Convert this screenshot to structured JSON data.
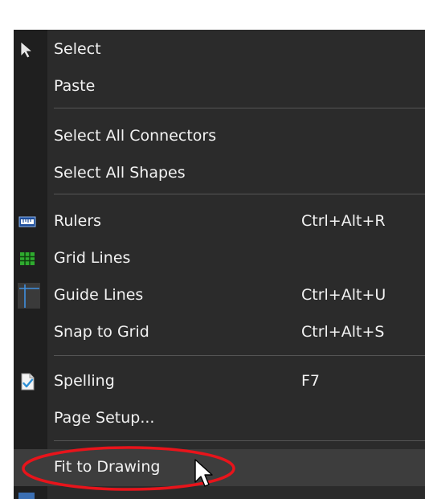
{
  "menu": {
    "items": [
      {
        "label": "Select",
        "shortcut": "",
        "icon": "arrow-cursor-icon"
      },
      {
        "label": "Paste",
        "shortcut": "",
        "icon": ""
      },
      {
        "label": "Select All Connectors",
        "shortcut": "",
        "icon": ""
      },
      {
        "label": "Select All Shapes",
        "shortcut": "",
        "icon": ""
      },
      {
        "label": "Rulers",
        "shortcut": "Ctrl+Alt+R",
        "icon": "ruler-icon"
      },
      {
        "label": "Grid Lines",
        "shortcut": "",
        "icon": "grid-icon"
      },
      {
        "label": "Guide Lines",
        "shortcut": "Ctrl+Alt+U",
        "icon": "guide-lines-icon"
      },
      {
        "label": "Snap to Grid",
        "shortcut": "Ctrl+Alt+S",
        "icon": ""
      },
      {
        "label": "Spelling",
        "shortcut": "F7",
        "icon": "spelling-check-icon"
      },
      {
        "label": "Page Setup...",
        "shortcut": "",
        "icon": ""
      },
      {
        "label": "Fit to Drawing",
        "shortcut": "",
        "icon": ""
      }
    ],
    "highlighted_item": "Fit to Drawing",
    "annotation_color": "#e8141b"
  }
}
